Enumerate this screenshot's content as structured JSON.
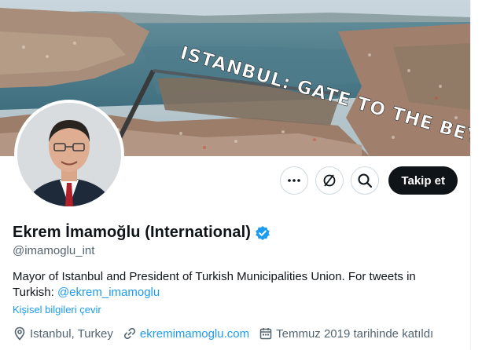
{
  "banner": {
    "headline": "ISTANBUL: GATE TO THE BEYOND"
  },
  "actions": {
    "more_icon": "more-icon",
    "notify_icon": "notifications-off-icon",
    "search_icon": "search-icon",
    "follow_label": "Takip et"
  },
  "profile": {
    "display_name": "Ekrem İmamoğlu (International)",
    "verified_icon": "verified-badge-icon",
    "handle": "@imamoglu_int",
    "bio_text": "Mayor of Istanbul and President of Turkish Municipalities Union. For tweets in Turkish: ",
    "bio_mention": "@ekrem_imamoglu",
    "translate_label": "Kişisel bilgileri çevir",
    "location": "Istanbul, Turkey",
    "website": "ekremimamoglu.com",
    "joined": "Temmuz 2019 tarihinde katıldı"
  },
  "colors": {
    "accent": "#1d9bf0",
    "text_primary": "#0f1419",
    "text_secondary": "#536471",
    "follow_bg": "#0f1419"
  }
}
